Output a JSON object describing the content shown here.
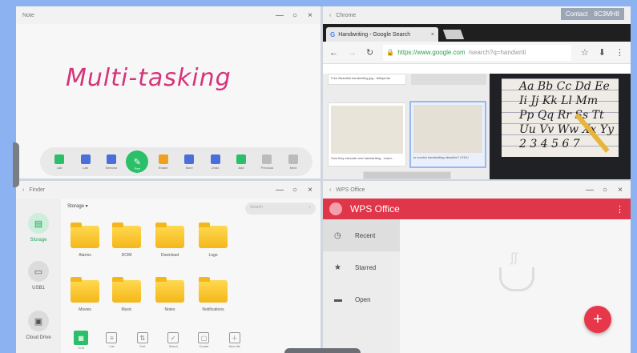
{
  "note": {
    "title": "Note",
    "handwriting": "Multi-tasking",
    "ink_color": "#d6337a",
    "toolbar": [
      {
        "label": "Lab",
        "icon": "flask-icon",
        "color": "#2bbf6a"
      },
      {
        "label": "Lab",
        "icon": "layers-icon",
        "color": "#4a6fd9"
      },
      {
        "label": "Selector",
        "icon": "cursor-icon",
        "color": "#4a6fd9"
      },
      {
        "label": "Pen",
        "icon": "pen-icon",
        "color": "#2bbf6a",
        "active": true
      },
      {
        "label": "Eraser",
        "icon": "eraser-icon",
        "color": "#f0a020"
      },
      {
        "label": "More",
        "icon": "more-icon",
        "color": "#4a6fd9"
      },
      {
        "label": "Undo",
        "icon": "undo-icon",
        "color": "#4a6fd9"
      },
      {
        "label": "Add",
        "icon": "add-page-icon",
        "color": "#2bbf6a"
      },
      {
        "label": "Previous",
        "icon": "prev-page-icon",
        "color": "#bbbbbb"
      },
      {
        "label": "Next",
        "icon": "next-page-icon",
        "color": "#bbbbbb"
      }
    ]
  },
  "chrome": {
    "title": "Chrome",
    "contact_label": "Contact",
    "contact_code": "8C3MH8",
    "tab_title": "Handwriting - Google Search",
    "tab_close": "×",
    "url_scheme": "https://www.google.com",
    "url_path": "/search?q=handwriti",
    "results": [
      {
        "caption": "Free Beautiful handwriting jpg - Wikipedia"
      },
      {
        "caption": ""
      },
      {
        "caption": "How they  educate new  handwriting - Learn..."
      },
      {
        "caption": "Is cursive handwriting obsolete? | EDU"
      }
    ],
    "preview_lines": [
      "Aa Bb Cc Dd Ee",
      "Ii Jj Kk Ll Mm",
      "Pp Qq Rr Ss Tt",
      "Uu Vv Ww Xx Yy",
      "2 3 4 5 6 7"
    ]
  },
  "finder": {
    "title": "Finder",
    "breadcrumb": "Storage ▾",
    "search_placeholder": "Search",
    "side": [
      {
        "label": "Storage",
        "icon": "storage-icon",
        "active": true
      },
      {
        "label": "USB1",
        "icon": "usb-icon"
      },
      {
        "label": "Cloud Drive",
        "icon": "cloud-drive-icon"
      }
    ],
    "folders": [
      "Alarms",
      "DCIM",
      "Download",
      "Logo",
      "Movies",
      "Music",
      "Notes",
      "Notifications"
    ],
    "toolbar": [
      {
        "label": "Grid",
        "icon": "grid-icon",
        "active": true
      },
      {
        "label": "List",
        "icon": "list-icon"
      },
      {
        "label": "Sort",
        "icon": "sort-icon"
      },
      {
        "label": "Select",
        "icon": "select-icon"
      },
      {
        "label": "Create",
        "icon": "new-folder-icon"
      },
      {
        "label": "New file",
        "icon": "new-file-icon"
      }
    ]
  },
  "wps": {
    "title": "WPS Office",
    "app_name": "WPS Office",
    "brand_color": "#e0364a",
    "menu": [
      {
        "label": "Recent",
        "icon": "clock-icon",
        "active": true
      },
      {
        "label": "Starred",
        "icon": "star-icon"
      },
      {
        "label": "Open",
        "icon": "folder-icon"
      }
    ],
    "fab": "+"
  },
  "window_controls": {
    "minimize": "—",
    "maximize": "○",
    "close": "×",
    "back": "‹"
  }
}
